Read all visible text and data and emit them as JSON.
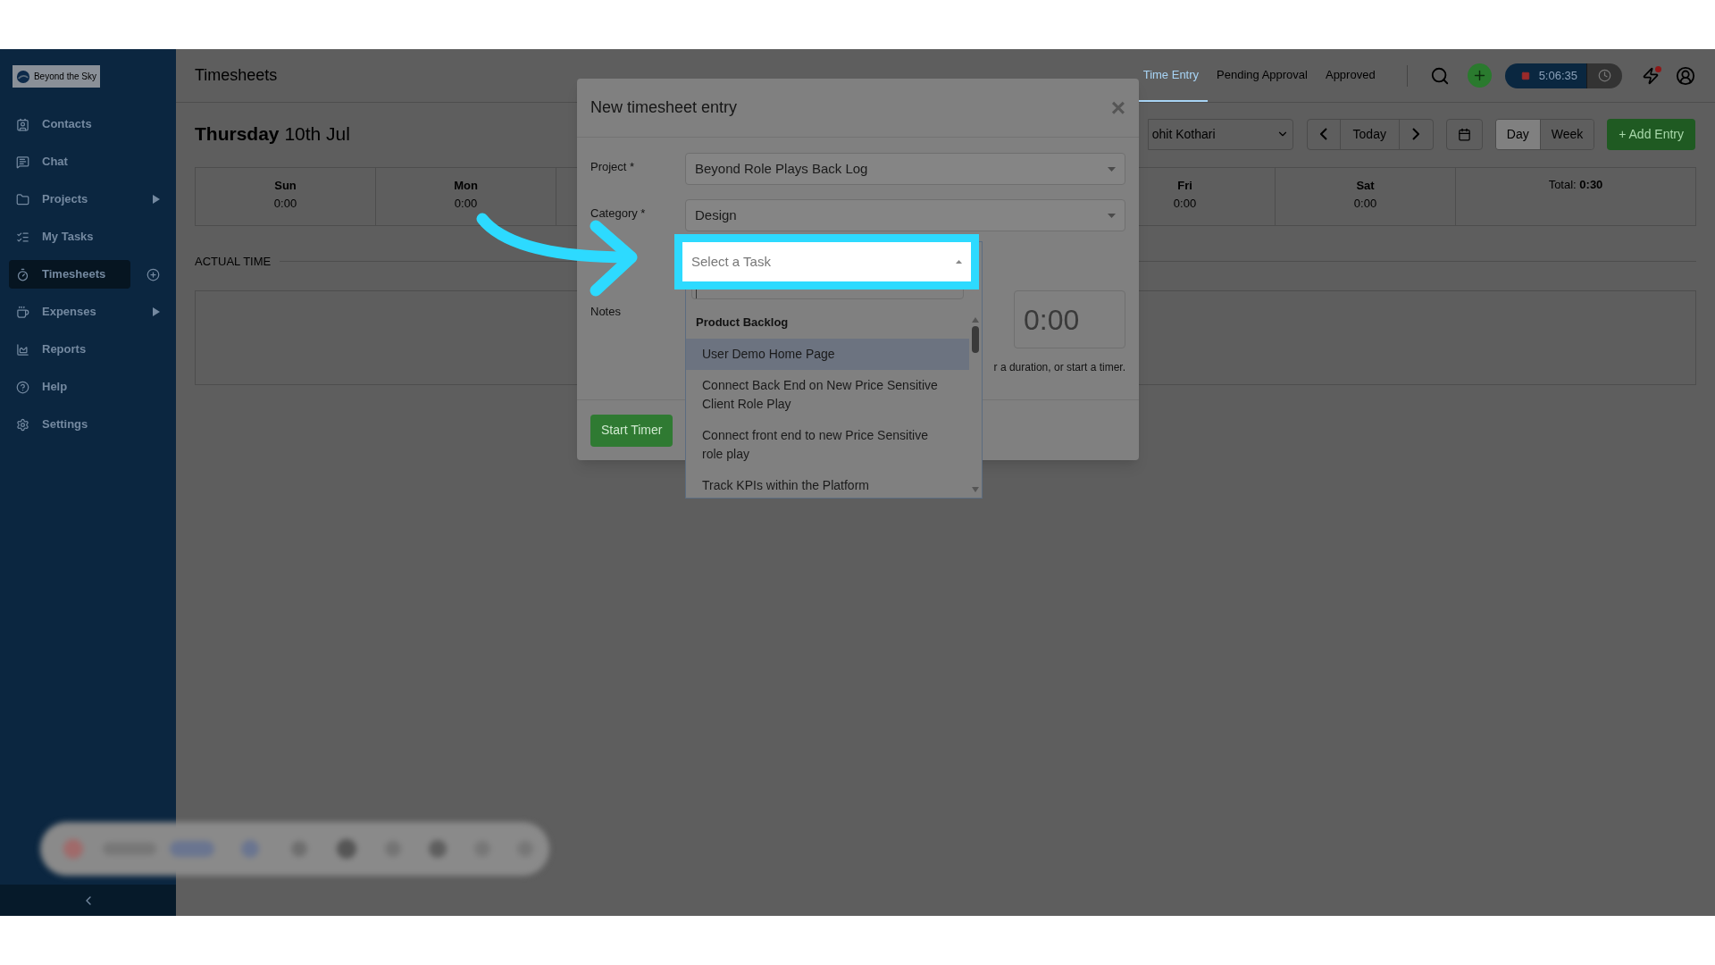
{
  "sidebar": {
    "logo": "Beyond the Sky",
    "items": [
      {
        "label": "Contacts",
        "selected": false,
        "submenu": false
      },
      {
        "label": "Chat",
        "selected": false,
        "submenu": false
      },
      {
        "label": "Projects",
        "selected": false,
        "submenu": true
      },
      {
        "label": "My Tasks",
        "selected": false,
        "submenu": false
      },
      {
        "label": "Timesheets",
        "selected": true,
        "submenu": false
      },
      {
        "label": "Expenses",
        "selected": false,
        "submenu": true
      },
      {
        "label": "Reports",
        "selected": false,
        "submenu": false
      },
      {
        "label": "Help",
        "selected": false,
        "submenu": false
      },
      {
        "label": "Settings",
        "selected": false,
        "submenu": false
      }
    ]
  },
  "header": {
    "title": "Timesheets",
    "tabs": [
      {
        "label": "Time Entry",
        "selected": true
      },
      {
        "label": "Pending Approval",
        "selected": false
      },
      {
        "label": "Approved",
        "selected": false
      }
    ],
    "timer": "5:06:35"
  },
  "date": {
    "weekday": "Thursday",
    "day": "10th Jul"
  },
  "toolbar": {
    "user": "ohit Kothari",
    "today": "Today",
    "views": [
      {
        "label": "Day",
        "selected": true
      },
      {
        "label": "Week",
        "selected": false
      }
    ],
    "add": "+ Add Entry"
  },
  "week": [
    {
      "day": "Sun",
      "time": "0:00"
    },
    {
      "day": "Mon",
      "time": "0:00"
    }
  ],
  "week_right": [
    {
      "day": "Fri",
      "time": "0:00"
    },
    {
      "day": "Sat",
      "time": "0:00"
    }
  ],
  "total": "Total: **0:30**",
  "section": "ACTUAL TIME",
  "modal": {
    "title": "New timesheet entry",
    "close": "×",
    "fields": [
      {
        "label": "Project *",
        "value": "Beyond Role Plays Back Log"
      },
      {
        "label": "Category *",
        "value": "Design"
      }
    ],
    "notes_label": "Notes",
    "duration": "0:00",
    "hint": "r a duration, or start a timer.",
    "start": "Start Timer"
  },
  "task_select": {
    "placeholder": "Select a Task",
    "group": "Product Backlog",
    "options": [
      {
        "label": "User Demo Home Page",
        "highlighted": true
      },
      {
        "label": "Connect Back End on New Price Sensitive Client Role Play",
        "highlighted": false
      },
      {
        "label": "Connect front end to new Price Sensitive role play",
        "highlighted": false
      },
      {
        "label": "Track KPIs within the Platform",
        "highlighted": false
      }
    ]
  }
}
